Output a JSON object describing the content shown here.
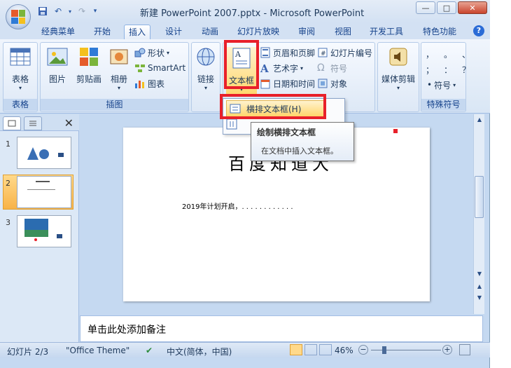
{
  "window": {
    "title": "新建 PowerPoint 2007.pptx - Microsoft PowerPoint",
    "minimize": "—",
    "restore": "□",
    "close": "✕"
  },
  "tabs": [
    "经典菜单",
    "开始",
    "插入",
    "设计",
    "动画",
    "幻灯片放映",
    "审阅",
    "视图",
    "开发工具",
    "特色功能"
  ],
  "active_tab": "插入",
  "help": "?",
  "ribbon": {
    "table_group": {
      "label": "表格",
      "table_btn": "表格"
    },
    "image_group": {
      "label": "插图",
      "picture": "图片",
      "clipart": "剪贴画",
      "album": "相册",
      "shapes": "形状",
      "smartart": "SmartArt",
      "chart": "图表"
    },
    "link_group": {
      "link": "链接"
    },
    "text_group": {
      "textbox": "文本框",
      "header_footer": "页眉和页脚",
      "wordart": "艺术字",
      "datetime": "日期和时间",
      "slide_number": "幻灯片编号",
      "symbol": "符号",
      "object": "对象"
    },
    "media_group": {
      "media": "媒体剪辑"
    },
    "special_group": {
      "label": "特殊符号",
      "symbol": "符号",
      "chars": [
        "，",
        "。",
        "、",
        "；",
        "：",
        "？"
      ]
    }
  },
  "dropdown": {
    "horizontal_textbox": "横排文本框(H)"
  },
  "tooltip": {
    "title": "绘制横排文本框",
    "description": "在文档中插入文本框。"
  },
  "thumbnails": {
    "numbers": [
      "1",
      "2",
      "3"
    ],
    "close": "✕"
  },
  "slide": {
    "title": "百度知道大",
    "body": "2019年计划开启，. . . . . . . . . . . ."
  },
  "notes": {
    "placeholder": "单击此处添加备注"
  },
  "status": {
    "slide_info": "幻灯片 2/3",
    "theme": "\"Office Theme\"",
    "language": "中文(简体，中国)",
    "zoom": "46%"
  },
  "colors": {
    "highlight_red": "#e8202a",
    "ribbon_bg": "#dae6f5",
    "selected_thumb": "#f8b348"
  }
}
